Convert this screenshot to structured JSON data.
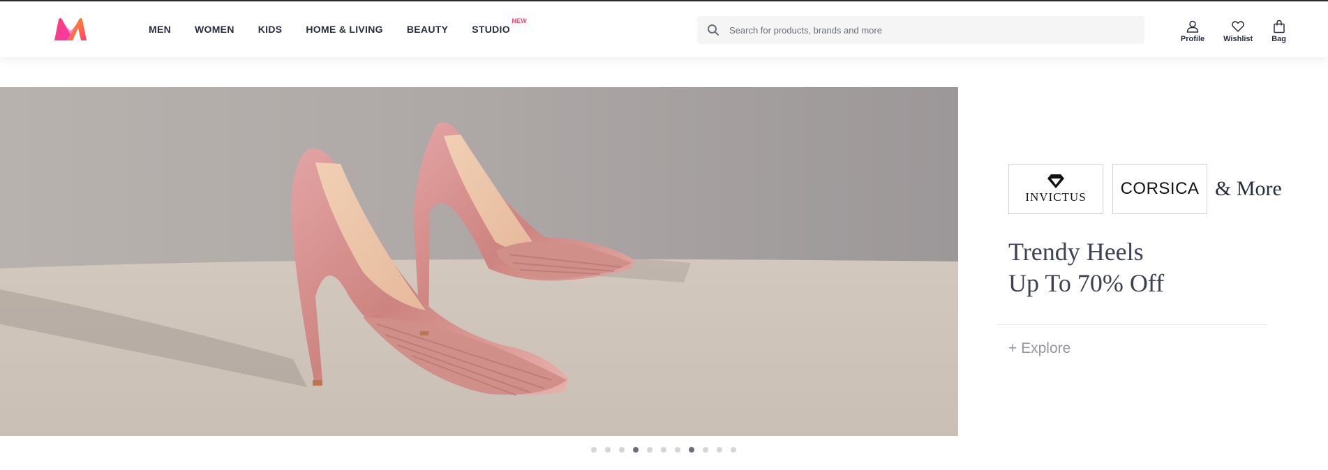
{
  "header": {
    "nav": [
      {
        "label": "MEN"
      },
      {
        "label": "WOMEN"
      },
      {
        "label": "KIDS"
      },
      {
        "label": "HOME & LIVING"
      },
      {
        "label": "BEAUTY"
      },
      {
        "label": "STUDIO",
        "badge": "NEW"
      }
    ],
    "search": {
      "placeholder": "Search for products, brands and more",
      "value": ""
    },
    "actions": [
      {
        "label": "Profile",
        "icon": "user-icon"
      },
      {
        "label": "Wishlist",
        "icon": "heart-icon"
      },
      {
        "label": "Bag",
        "icon": "bag-icon"
      }
    ]
  },
  "promo": {
    "brands": [
      {
        "name": "INVICTUS",
        "icon": "diamond-logo"
      },
      {
        "name": "CORSICA"
      }
    ],
    "and_more": "& More",
    "headline_line1": "Trendy Heels",
    "headline_line2": "Up To 70% Off",
    "cta": "+ Explore"
  },
  "carousel": {
    "slide_count": 11,
    "active_slides": [
      3,
      7
    ]
  },
  "colors": {
    "accent": "#ff3f6c",
    "text": "#282c3f",
    "muted": "#94969f",
    "search_bg": "#f5f5f6"
  }
}
